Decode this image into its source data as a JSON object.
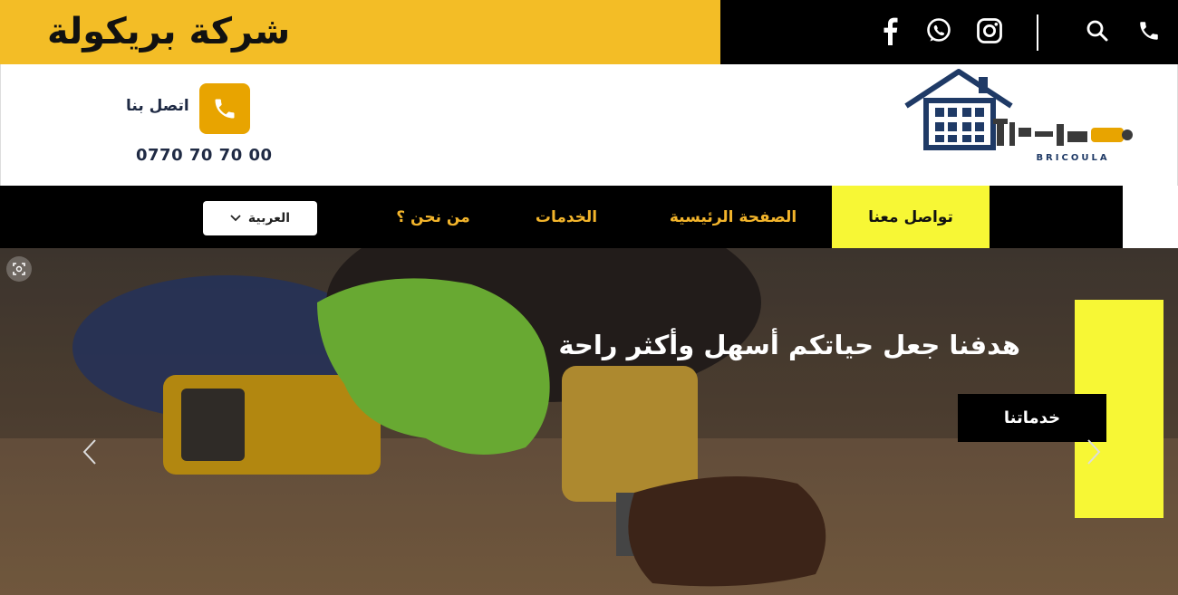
{
  "topbar": {
    "brand_name": "شركة بريكولة",
    "icons": [
      "facebook-icon",
      "whatsapp-icon",
      "instagram-icon",
      "search-icon",
      "phone-icon"
    ]
  },
  "header": {
    "logo_caption": "BRICOULA",
    "contact_label": "اتصل بنا",
    "phone_number": "0770 70 70 00"
  },
  "nav": {
    "items": [
      {
        "label": "تواصل معنا",
        "active": true
      },
      {
        "label": "الصفحة الرئيسية",
        "active": false
      },
      {
        "label": "الخدمات",
        "active": false
      },
      {
        "label": "من نحن ؟",
        "active": false
      }
    ],
    "language": "العربية"
  },
  "hero": {
    "heading": "هدفنا جعل حياتكم أسهل وأكثر راحة",
    "button_label": "خدماتنا"
  },
  "colors": {
    "brand_yellow": "#f3bd26",
    "nav_text": "#f2b42b",
    "active_yellow": "#f7f735",
    "phone_badge": "#e8a400",
    "logo_navy": "#1f3a66"
  }
}
